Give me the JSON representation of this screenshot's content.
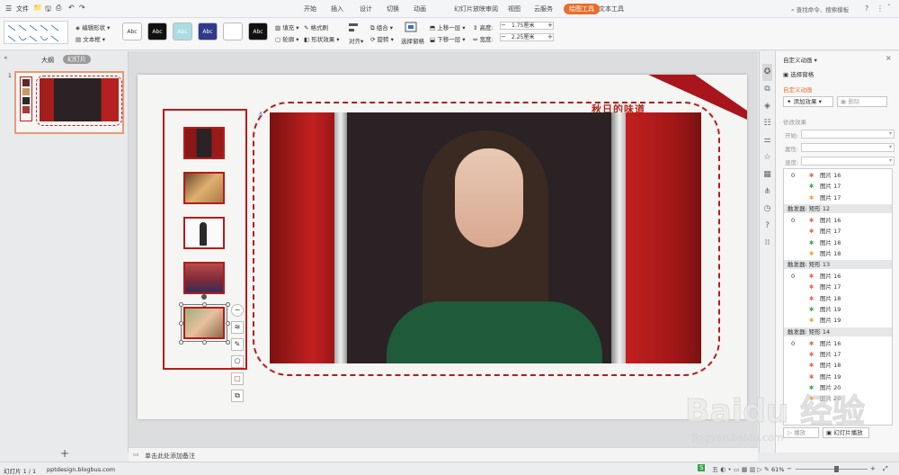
{
  "menubar": {
    "file_label": "文件",
    "tabs": [
      "开始",
      "插入",
      "设计",
      "切换",
      "动画",
      "幻灯片放映",
      "审阅",
      "视图",
      "云服务",
      "绘图工具",
      "文本工具"
    ],
    "active_tab": "绘图工具",
    "search_placeholder": "查找命令、搜索模板"
  },
  "ribbon": {
    "edit_shape": "编辑形状",
    "textbox": "文本框",
    "style_swatches": [
      {
        "label": "Abc",
        "bg": "#ffffff",
        "fg": "#333333"
      },
      {
        "label": "Abc",
        "bg": "#111111",
        "fg": "#ffffff"
      },
      {
        "label": "Abc",
        "bg": "#a9dde3",
        "fg": "#ffffff"
      },
      {
        "label": "Abc",
        "bg": "#2f3a8c",
        "fg": "#ffffff"
      },
      {
        "label": "Abc",
        "bg": "#ffffff",
        "fg": "#ffffff"
      },
      {
        "label": "Abc",
        "bg": "#111111",
        "fg": "#ffffff"
      }
    ],
    "fill": "填充",
    "format_painter": "格式刷",
    "outline": "轮廓",
    "shape_effect": "形状效果",
    "align": "对齐",
    "group": "组合",
    "rotate": "旋转",
    "select_pane": "选择窗格",
    "bring_forward": "上移一层",
    "send_backward": "下移一层",
    "height_label": "高度:",
    "height_value": "1.75厘米",
    "width_label": "宽度:",
    "width_value": "2.25厘米"
  },
  "leftpanel": {
    "tab_outline": "大纲",
    "tab_slides": "幻灯片",
    "slide_number": "1"
  },
  "slide": {
    "title_text": "秋日的味道"
  },
  "rightpanel": {
    "title": "自定义动画",
    "select_pane": "选择窗格",
    "section_title": "自定义动画",
    "add_effect": "添加效果",
    "delete": "删除",
    "modify_effect": "修改效果",
    "start_label": "开始:",
    "property_label": "属性:",
    "speed_label": "速度:",
    "list": [
      {
        "kind": "row",
        "num": "0",
        "label": "图片 16",
        "color": "#e8604a"
      },
      {
        "kind": "row",
        "num": "",
        "label": "图片 17",
        "color": "#3aa04a"
      },
      {
        "kind": "row",
        "num": "",
        "label": "图片 17",
        "color": "#e8a23a"
      },
      {
        "kind": "trigger",
        "label": "触发器: 矩形 12"
      },
      {
        "kind": "row",
        "num": "0",
        "label": "图片 16",
        "color": "#e8604a"
      },
      {
        "kind": "row",
        "num": "",
        "label": "图片 17",
        "color": "#e8604a"
      },
      {
        "kind": "row",
        "num": "",
        "label": "图片 18",
        "color": "#3aa04a"
      },
      {
        "kind": "row",
        "num": "",
        "label": "图片 18",
        "color": "#e8a23a"
      },
      {
        "kind": "trigger",
        "label": "触发器: 矩形 13"
      },
      {
        "kind": "row",
        "num": "0",
        "label": "图片 16",
        "color": "#e8604a"
      },
      {
        "kind": "row",
        "num": "",
        "label": "图片 17",
        "color": "#e8604a"
      },
      {
        "kind": "row",
        "num": "",
        "label": "图片 18",
        "color": "#e8604a"
      },
      {
        "kind": "row",
        "num": "",
        "label": "图片 19",
        "color": "#3aa04a"
      },
      {
        "kind": "row",
        "num": "",
        "label": "图片 19",
        "color": "#e8a23a"
      },
      {
        "kind": "trigger",
        "label": "触发器: 矩形 14"
      },
      {
        "kind": "row",
        "num": "0",
        "label": "图片 16",
        "color": "#e8604a"
      },
      {
        "kind": "row",
        "num": "",
        "label": "图片 17",
        "color": "#e8604a"
      },
      {
        "kind": "row",
        "num": "",
        "label": "图片 18",
        "color": "#e8604a"
      },
      {
        "kind": "row",
        "num": "",
        "label": "图片 19",
        "color": "#e8604a"
      },
      {
        "kind": "row",
        "num": "",
        "label": "图片 20",
        "color": "#3aa04a"
      },
      {
        "kind": "row",
        "num": "",
        "label": "图片 20",
        "color": "#e8a23a"
      }
    ],
    "play": "播放",
    "slideshow": "幻灯片播放"
  },
  "notes_placeholder": "单击此处添加备注",
  "status": {
    "slide_info": "幻灯片 1 / 1",
    "site": "pptdesign.blogbus.com",
    "zoom": "61%"
  },
  "watermark": {
    "brand": "Baidu 经验",
    "url": "jingyan.baidu.com"
  }
}
